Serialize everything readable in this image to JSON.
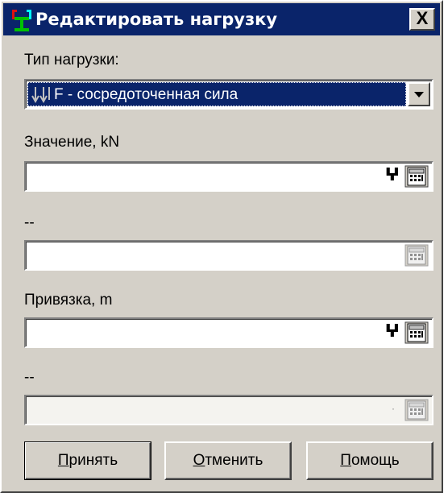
{
  "window": {
    "title": "Редактировать нагрузку",
    "close_label": "X"
  },
  "load_type": {
    "label": "Тип нагрузки:",
    "selected": "F - сосредоточенная сила"
  },
  "value": {
    "label": "Значение, kN",
    "value": "",
    "cursor_glyph": "?"
  },
  "second_value": {
    "label": "--",
    "value": ""
  },
  "anchor": {
    "label": "Привязка, m",
    "value": "",
    "cursor_glyph": "?"
  },
  "second_anchor": {
    "label": "--",
    "value": "",
    "marker": "·"
  },
  "buttons": {
    "accept_mnemonic": "П",
    "accept_rest": "ринять",
    "cancel_mnemonic": "О",
    "cancel_rest": "тменить",
    "help_mnemonic": "П",
    "help_rest": "омощь"
  },
  "colors": {
    "title_bg": "#0a246a",
    "dialog_bg": "#d4d0c8",
    "selection_bg": "#0a246a"
  }
}
